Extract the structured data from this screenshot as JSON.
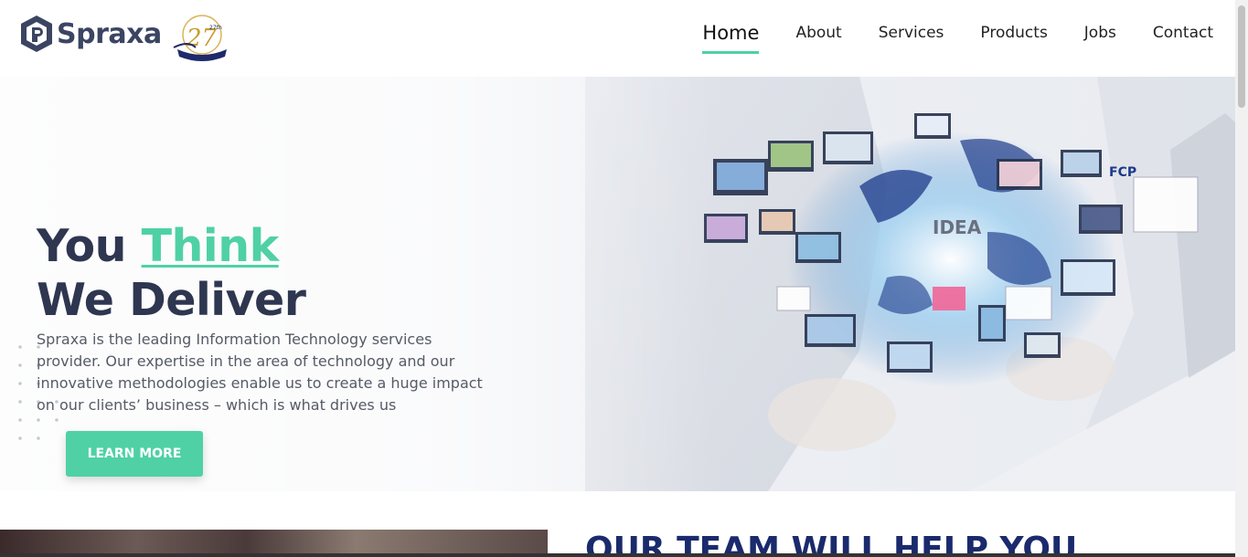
{
  "brand": {
    "name": "Spraxa",
    "logo_icon": "spraxa-logo-icon",
    "anniversary_badge": {
      "icon": "anniversary-27th-badge",
      "text": "27th"
    }
  },
  "nav": {
    "items": [
      {
        "label": "Home",
        "active": true
      },
      {
        "label": "About",
        "active": false
      },
      {
        "label": "Services",
        "active": false
      },
      {
        "label": "Products",
        "active": false
      },
      {
        "label": "Jobs",
        "active": false
      },
      {
        "label": "Contact",
        "active": false
      }
    ]
  },
  "hero": {
    "headline_line1_prefix": "You",
    "headline_line1_accent": "Think",
    "headline_line2": "We Deliver",
    "description": "Spraxa is the leading Information Technology services provider. Our expertise in the area of technology and our innovative methodologies enable us to create a huge impact on our clients’ business – which is what drives us",
    "cta_label": "LEARN MORE",
    "art_labels": {
      "idea": "IDEA",
      "fcp": "FCP"
    }
  },
  "team_section": {
    "heading": "OUR TEAM WILL HELP YOU"
  },
  "colors": {
    "accent": "#4fd1a5",
    "heading_dark": "#2e3650",
    "navy": "#1a2a6c"
  }
}
